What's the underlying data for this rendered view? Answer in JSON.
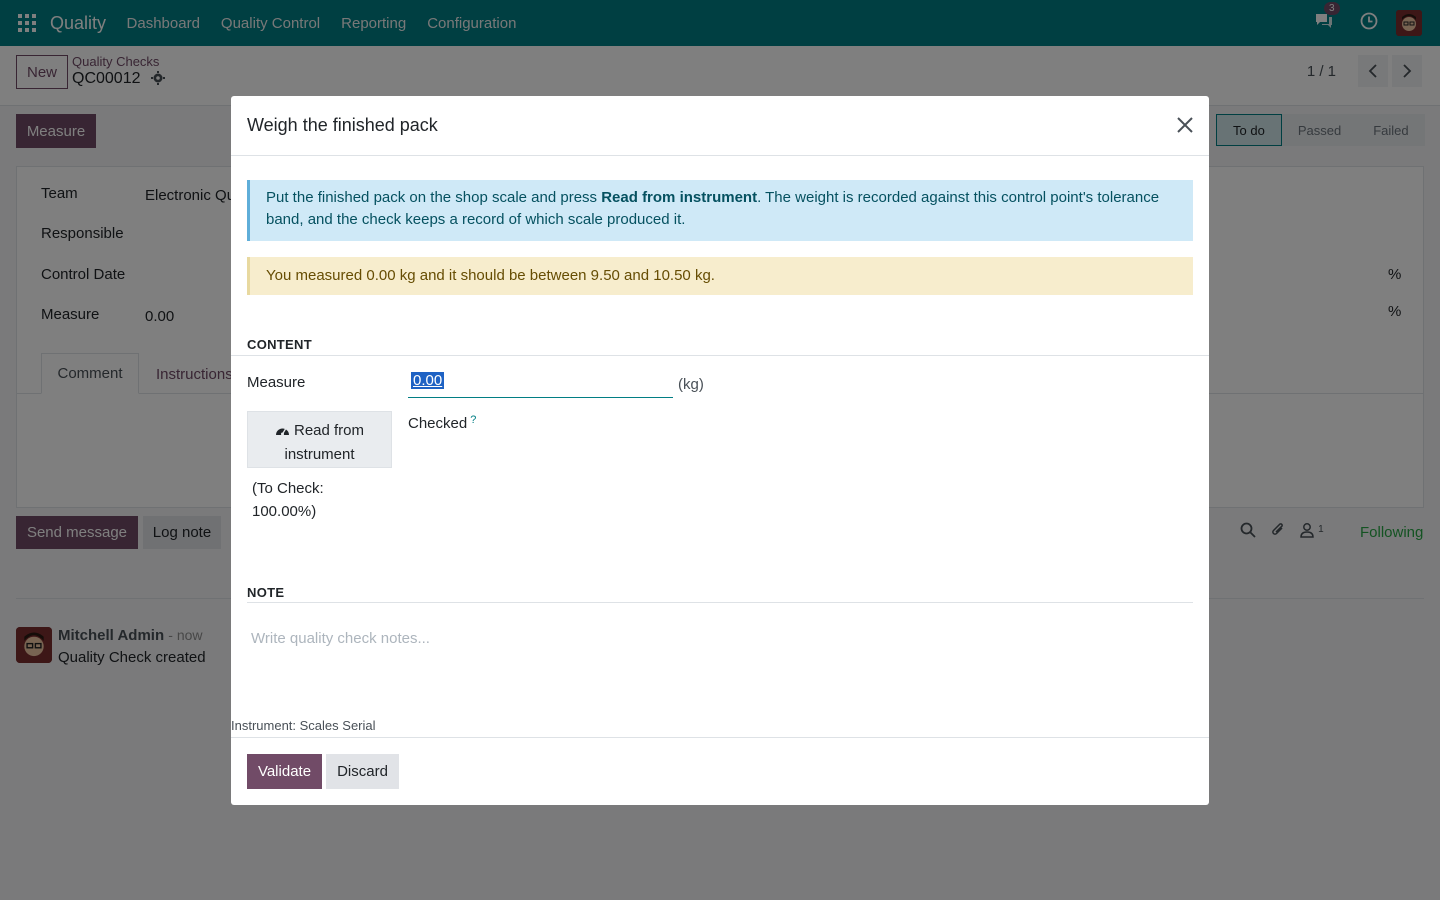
{
  "navbar": {
    "app_name": "Quality",
    "menu": [
      "Dashboard",
      "Quality Control",
      "Reporting",
      "Configuration"
    ],
    "chat_badge": "3"
  },
  "control_panel": {
    "new_label": "New",
    "breadcrumb": "Quality Checks",
    "record_name": "QC00012",
    "pager": "1 / 1"
  },
  "form": {
    "measure_button": "Measure",
    "status": [
      "To do",
      "Passed",
      "Failed"
    ],
    "fields": {
      "team_label": "Team",
      "team_value": "Electronic Qu",
      "responsible_label": "Responsible",
      "control_date_label": "Control Date",
      "measure_label": "Measure",
      "measure_value": "0.00",
      "pct1": "%",
      "pct2": "%"
    },
    "tabs": [
      "Comment",
      "Instructions"
    ]
  },
  "chatter": {
    "send_message": "Send message",
    "log_note": "Log note",
    "follower_count": "1",
    "following": "Following",
    "message": {
      "author": "Mitchell Admin",
      "time": "- now",
      "body": "Quality Check created"
    }
  },
  "dialog": {
    "title": "Weigh the finished pack",
    "info_pre": "Put the finished pack on the shop scale and press ",
    "info_bold": "Read from instrument",
    "info_post": ". The weight is recorded against this control point's tolerance band, and the check keeps a record of which scale produced it.",
    "warning": "You measured 0.00 kg and it should be between 9.50 and 10.50 kg.",
    "section_content": "CONTENT",
    "measure_label": "Measure",
    "measure_value": "0.00",
    "unit": "(kg)",
    "read_button": "Read from instrument",
    "checked_label": "Checked",
    "help_mark": "?",
    "to_check": "(To Check: 100.00%)",
    "section_note": "NOTE",
    "note_placeholder": "Write quality check notes...",
    "instrument": "Instrument: Scales Serial",
    "validate": "Validate",
    "discard": "Discard"
  },
  "colors": {
    "brand": "#017e84",
    "primary": "#714b67"
  }
}
